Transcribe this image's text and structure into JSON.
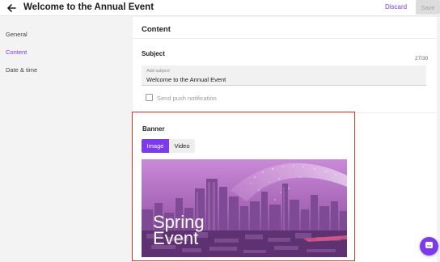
{
  "header": {
    "title": "Welcome to the Annual Event",
    "discard_label": "Discard",
    "save_label": "Save"
  },
  "sidebar": {
    "items": [
      {
        "label": "General"
      },
      {
        "label": "Content"
      },
      {
        "label": "Date & time"
      }
    ],
    "active": "Content"
  },
  "content": {
    "title": "Content",
    "subject": {
      "label": "Subject",
      "placeholder": "Add subject",
      "value": "Welcome to the Annual Event",
      "counter": "27/30"
    },
    "push_notification": {
      "label": "Send push notification",
      "checked": false
    },
    "banner": {
      "label": "Banner",
      "tabs": [
        {
          "label": "Image"
        },
        {
          "label": "Video"
        }
      ],
      "active_tab": "Image",
      "image_text_line1": "Spring",
      "image_text_line2": "Event"
    }
  },
  "colors": {
    "accent": "#7c3aed",
    "highlight_border": "#e0352b"
  }
}
